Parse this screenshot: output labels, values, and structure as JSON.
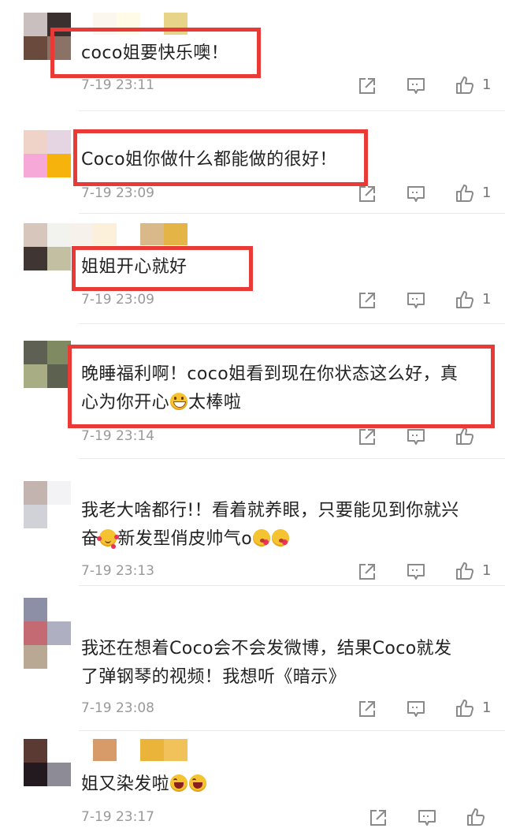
{
  "comments": [
    {
      "text": "coco姐要快乐噢！",
      "time": "7-19 23:11",
      "likes": "1"
    },
    {
      "text": "Coco姐你做什么都能做的很好！",
      "time": "7-19 23:09",
      "likes": "1"
    },
    {
      "text": "姐姐开心就好",
      "time": "7-19 23:09",
      "likes": "1"
    },
    {
      "text_line1": "晚睡福利啊！coco姐看到现在你状态这么好，真",
      "text_line2_a": "心为你开心",
      "text_line2_b": "太棒啦",
      "time": "7-19 23:14"
    },
    {
      "text_line1": "我老大啥都行!！看着就养眼，只要能见到你就兴",
      "text_line2_a": "奋",
      "text_line2_b": "新发型俏皮帅气o",
      "time": "7-19 23:13",
      "likes": "1"
    },
    {
      "text_line1": "我还在想着Coco会不会发微博，结果Coco就发",
      "text_line2": "了弹钢琴的视频！我想听《暗示》",
      "time": "7-19 23:08",
      "likes": "1"
    },
    {
      "text": "姐又染发啦",
      "time": "7-19 23:17"
    }
  ],
  "icons": {
    "share": "share-out-icon",
    "reply": "comment-icon",
    "like": "thumb-up-icon",
    "emoji": "emoji-icon"
  },
  "colors": {
    "highlight": "#ea3a35",
    "text": "#222222",
    "meta": "#999999",
    "icon": "#8a8a8a"
  }
}
